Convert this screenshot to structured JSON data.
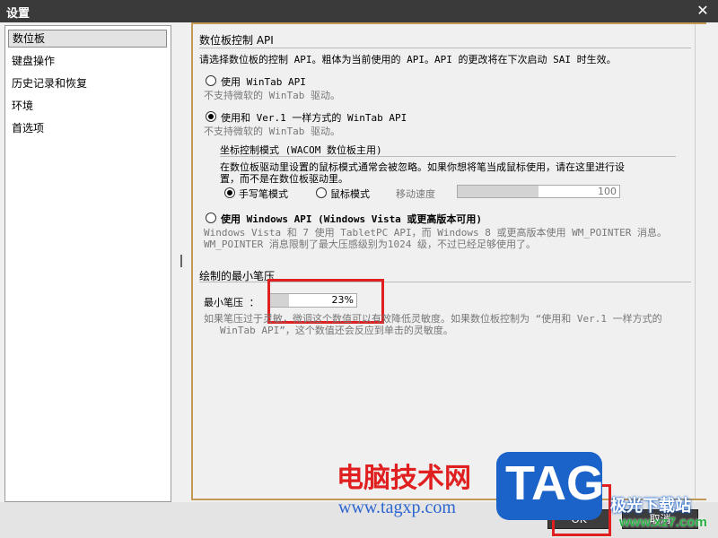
{
  "window": {
    "title": "设置"
  },
  "sidebar": {
    "items": [
      {
        "label": "数位板"
      },
      {
        "label": "键盘操作"
      },
      {
        "label": "历史记录和恢复"
      },
      {
        "label": "环境"
      },
      {
        "label": "首选项"
      }
    ]
  },
  "tablet_api": {
    "section_title": "数位板控制 API",
    "description": "请选择数位板的控制 API。粗体为当前使用的 API。API 的更改将在下次启动 SAI 时生效。",
    "option1": {
      "label": "使用 WinTab API",
      "note": "不支持微软的 WinTab 驱动。",
      "selected": false
    },
    "option2": {
      "label": "使用和 Ver.1 一样方式的 WinTab API",
      "note": "不支持微软的 WinTab 驱动。",
      "selected": true
    },
    "coord": {
      "title": "坐标控制模式 (WACOM 数位板主用)",
      "desc_line1": "在数位板驱动里设置的鼠标模式通常会被忽略。如果你想将笔当成鼠标使用，请在这里进行设",
      "desc_line2": "置，而不是在数位板驱动里。",
      "mode_pen": "手写笔模式",
      "mode_mouse": "鼠标模式",
      "speed_label": "移动速度",
      "speed_value": "100",
      "speed_fraction": 0.5
    },
    "option3": {
      "label": "使用 Windows API (Windows Vista 或更高版本可用)",
      "note_line1": "Windows Vista 和 7 使用 TabletPC API，而 Windows 8 或更高版本使用 WM_POINTER 消息。",
      "note_line2": "WM_POINTER 消息限制了最大压感级别为1024 级，不过已经足够使用了。",
      "selected": false
    }
  },
  "min_pressure": {
    "section_title": "绘制的最小笔压",
    "label": "最小笔压 ：",
    "value": "23%",
    "fraction": 0.23,
    "hint_line1": "如果笔压过于灵敏，微调这个数值可以有效降低灵敏度。如果数位板控制为 “使用和 Ver.1 一样方式的",
    "hint_line2": "WinTab API”，这个数值还会反应到单击的灵敏度。"
  },
  "buttons": {
    "ok": "OK",
    "cancel": "取消"
  },
  "watermark": {
    "text1": "电脑技术网",
    "url": "www.tagxp.com",
    "logo": "TAG",
    "site": "极光下载站",
    "site_url": "www.xz7.com"
  },
  "colors": {
    "accent": "#c39a55",
    "highlight": "#e02020",
    "titlebar": "#3a3a3a"
  }
}
